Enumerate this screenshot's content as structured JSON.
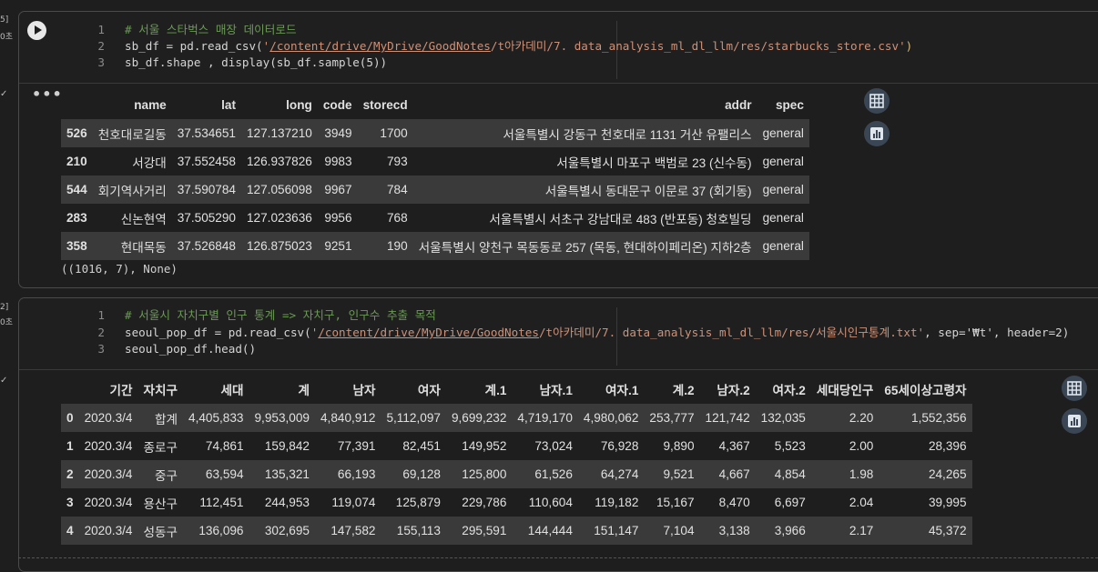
{
  "cells": [
    {
      "exec_count": "5]",
      "exec_time": "0초",
      "code": [
        {
          "n": "1",
          "comment": "# 서울 스타벅스 매장 데이터로드"
        },
        {
          "n": "2",
          "pre": "sb_df = pd.read_csv(",
          "str_open": "'",
          "str_link": "/content/drive/MyDrive/GoodNotes",
          "str_rest": "/t아카데미/7. data_analysis_ml_dl_llm/res/starbucks_store.csv'",
          "post": ")"
        },
        {
          "n": "3",
          "pre": "sb_df.shape , display(sb_df.sample(5))"
        }
      ],
      "table": {
        "columns": [
          "",
          "name",
          "lat",
          "long",
          "code",
          "storecd",
          "addr",
          "spec"
        ],
        "rows": [
          [
            "526",
            "천호대로길동",
            "37.534651",
            "127.137210",
            "3949",
            "1700",
            "서울특별시 강동구 천호대로 1131 거산 유팰리스",
            "general"
          ],
          [
            "210",
            "서강대",
            "37.552458",
            "126.937826",
            "9983",
            "793",
            "서울특별시 마포구 백범로 23 (신수동)",
            "general"
          ],
          [
            "544",
            "회기역사거리",
            "37.590784",
            "127.056098",
            "9967",
            "784",
            "서울특별시 동대문구 이문로 37 (회기동)",
            "general"
          ],
          [
            "283",
            "신논현역",
            "37.505290",
            "127.023636",
            "9956",
            "768",
            "서울특별시 서초구 강남대로 483 (반포동) 청호빌딩",
            "general"
          ],
          [
            "358",
            "현대목동",
            "37.526848",
            "126.875023",
            "9251",
            "190",
            "서울특별시 양천구 목동동로 257 (목동, 현대하이페리온) 지하2층",
            "general"
          ]
        ]
      },
      "plain_output": "((1016, 7), None)"
    },
    {
      "exec_count": "2]",
      "exec_time": "0초",
      "code": [
        {
          "n": "1",
          "comment": "# 서울시 자치구별 인구 통계 => 자치구, 인구수 추출 목적"
        },
        {
          "n": "2",
          "pre": "seoul_pop_df = pd.read_csv(",
          "str_open": "'",
          "str_link": "/content/drive/MyDrive/GoodNotes",
          "str_rest": "/t아카데미/7. data_analysis_ml_dl_llm/res/서울시인구통계.txt'",
          "post": ", sep='₩t', header=2)"
        },
        {
          "n": "3",
          "pre": "seoul_pop_df.head()"
        }
      ],
      "table": {
        "columns": [
          "",
          "기간",
          "자치구",
          "세대",
          "계",
          "남자",
          "여자",
          "계.1",
          "남자.1",
          "여자.1",
          "계.2",
          "남자.2",
          "여자.2",
          "세대당인구",
          "65세이상고령자"
        ],
        "rows": [
          [
            "0",
            "2020.3/4",
            "합계",
            "4,405,833",
            "9,953,009",
            "4,840,912",
            "5,112,097",
            "9,699,232",
            "4,719,170",
            "4,980,062",
            "253,777",
            "121,742",
            "132,035",
            "2.20",
            "1,552,356"
          ],
          [
            "1",
            "2020.3/4",
            "종로구",
            "74,861",
            "159,842",
            "77,391",
            "82,451",
            "149,952",
            "73,024",
            "76,928",
            "9,890",
            "4,367",
            "5,523",
            "2.00",
            "28,396"
          ],
          [
            "2",
            "2020.3/4",
            "중구",
            "63,594",
            "135,321",
            "66,193",
            "69,128",
            "125,800",
            "61,526",
            "64,274",
            "9,521",
            "4,667",
            "4,854",
            "1.98",
            "24,265"
          ],
          [
            "3",
            "2020.3/4",
            "용산구",
            "112,451",
            "244,953",
            "119,074",
            "125,879",
            "229,786",
            "110,604",
            "119,182",
            "15,167",
            "8,470",
            "6,697",
            "2.04",
            "39,995"
          ],
          [
            "4",
            "2020.3/4",
            "성동구",
            "136,096",
            "302,695",
            "147,582",
            "155,113",
            "295,591",
            "144,444",
            "151,147",
            "7,104",
            "3,138",
            "3,966",
            "2.17",
            "45,372"
          ]
        ]
      }
    }
  ],
  "icons": {
    "table_button": "table-icon",
    "chart_button": "bar-chart-icon",
    "output_menu": "ellipsis-icon",
    "run": "play-icon"
  },
  "colors": {
    "comment": "#6a9955",
    "string": "#ce9178",
    "row_stripe": "#3a3a3a",
    "background": "#1e1e1e"
  }
}
